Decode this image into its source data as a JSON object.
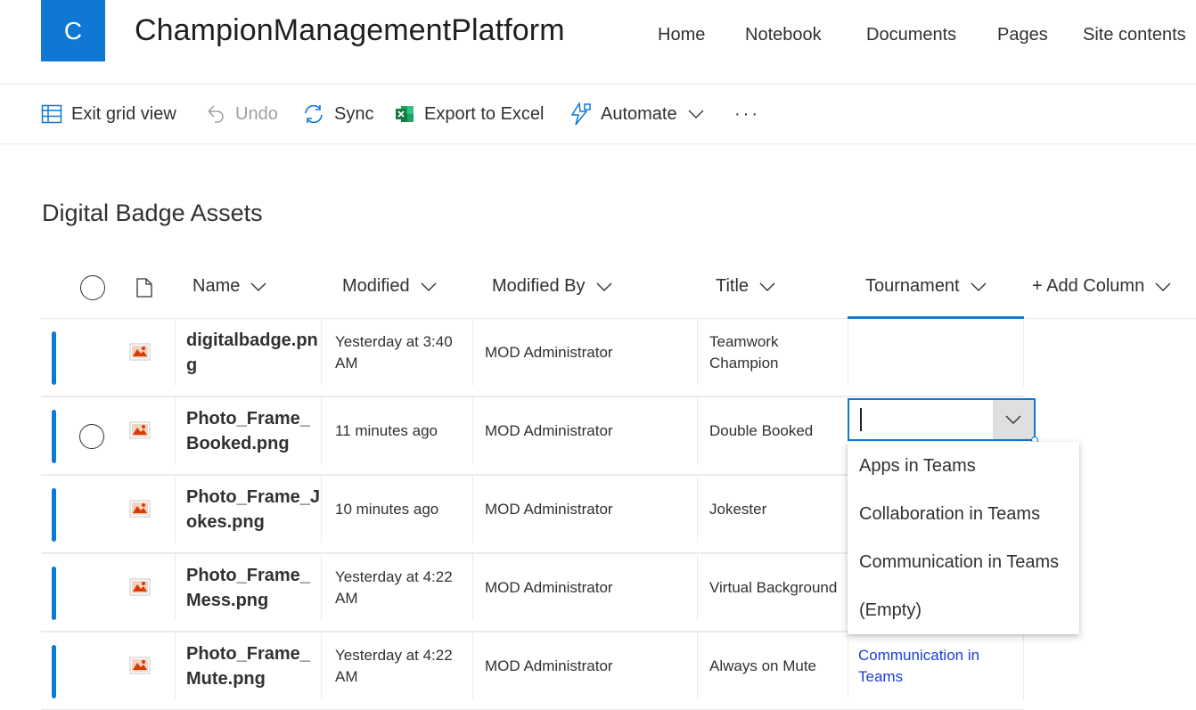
{
  "site": {
    "logo_letter": "C",
    "title": "ChampionManagementPlatform",
    "nav": [
      "Home",
      "Notebook",
      "Documents",
      "Pages",
      "Site contents"
    ]
  },
  "commands": {
    "exit_grid": "Exit grid view",
    "undo": "Undo",
    "sync": "Sync",
    "export": "Export to Excel",
    "automate": "Automate",
    "more": "···"
  },
  "list": {
    "title": "Digital Badge Assets",
    "columns": {
      "name": "Name",
      "modified": "Modified",
      "modified_by": "Modified By",
      "title": "Title",
      "tournament": "Tournament",
      "add": "+ Add Column"
    },
    "rows": [
      {
        "name": "digitalbadge.png",
        "modified": "Yesterday at 3:40 AM",
        "modified_by": "MOD Administrator",
        "title": "Teamwork Champion",
        "tournament": ""
      },
      {
        "name": "Photo_Frame_Booked.png",
        "modified": "11 minutes ago",
        "modified_by": "MOD Administrator",
        "title": "Double Booked",
        "tournament": ""
      },
      {
        "name": "Photo_Frame_Jokes.png",
        "modified": "10 minutes ago",
        "modified_by": "MOD Administrator",
        "title": "Jokester",
        "tournament": ""
      },
      {
        "name": "Photo_Frame_Mess.png",
        "modified": "Yesterday at 4:22 AM",
        "modified_by": "MOD Administrator",
        "title": "Virtual Background",
        "tournament": ""
      },
      {
        "name": "Photo_Frame_Mute.png",
        "modified": "Yesterday at 4:22 AM",
        "modified_by": "MOD Administrator",
        "title": "Always on Mute",
        "tournament": "Communication in Teams"
      }
    ]
  },
  "tournament_editor": {
    "value": "",
    "options": [
      "Apps in Teams",
      "Collaboration in Teams",
      "Communication in Teams",
      "(Empty)"
    ]
  },
  "colors": {
    "accent": "#0f78d4",
    "link": "#1c3dd6",
    "divider": "#edebe9"
  }
}
